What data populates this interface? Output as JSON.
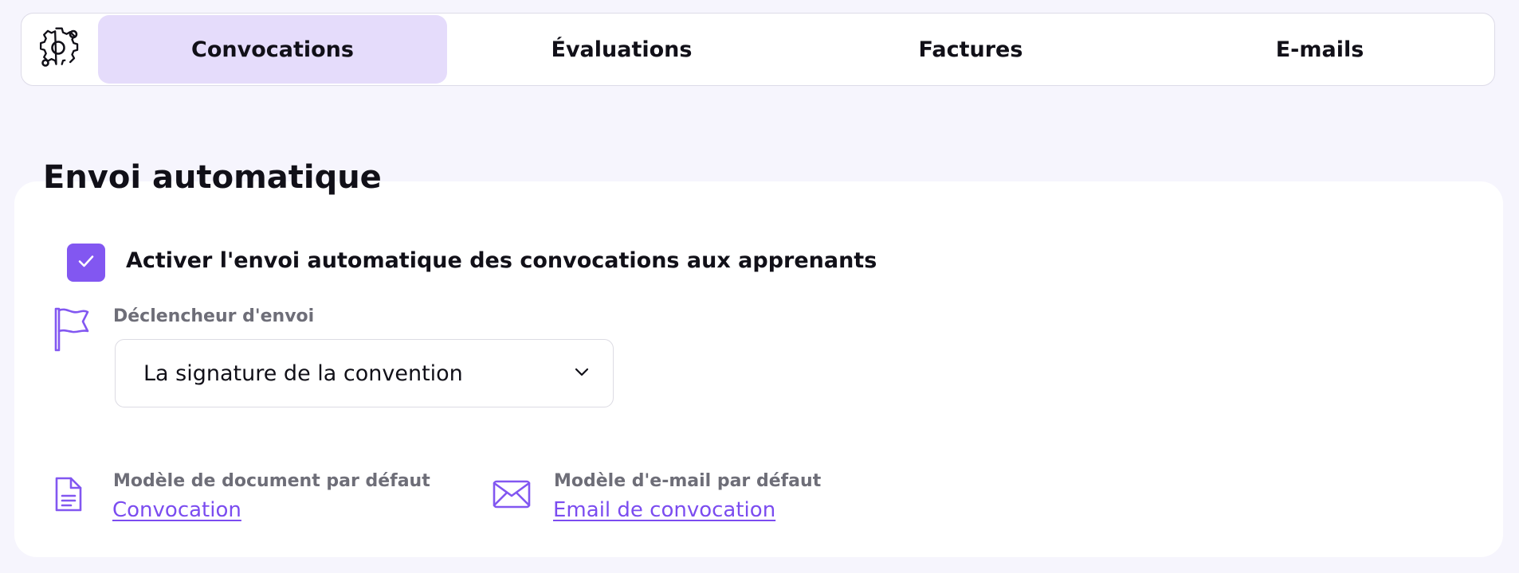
{
  "tabs": {
    "items": [
      {
        "label": "Convocations",
        "active": true
      },
      {
        "label": "Évaluations",
        "active": false
      },
      {
        "label": "Factures",
        "active": false
      },
      {
        "label": "E-mails",
        "active": false
      }
    ],
    "settings_icon": "gear-icon"
  },
  "section": {
    "title": "Envoi automatique"
  },
  "auto_send": {
    "checked": true,
    "label": "Activer l'envoi automatique des convocations aux apprenants"
  },
  "trigger": {
    "icon": "flag-icon",
    "label": "Déclencheur d'envoi",
    "value": "La signature de la convention"
  },
  "document_template": {
    "icon": "document-icon",
    "label": "Modèle de document par défaut",
    "link": "Convocation"
  },
  "email_template": {
    "icon": "envelope-icon",
    "label": "Modèle d'e-mail par défaut",
    "link": "Email de convocation"
  },
  "colors": {
    "accent": "#8257f1",
    "active_tab_bg": "#e5dcfb",
    "page_bg": "#f6f5fd",
    "link": "#7b4cf0"
  }
}
